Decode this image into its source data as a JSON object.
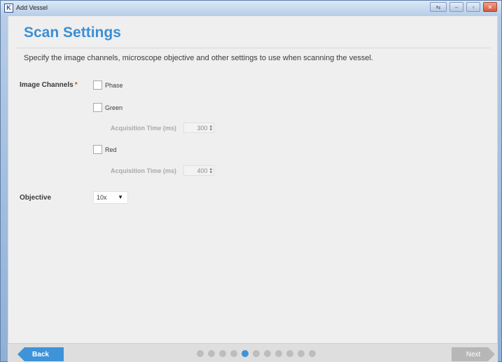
{
  "window": {
    "title": "Add Vessel",
    "icon_letter": "K",
    "buttons": [
      "restore-alt-icon",
      "minimize-icon",
      "maximize-icon",
      "close-icon"
    ]
  },
  "page": {
    "heading": "Scan Settings",
    "subtitle": "Specify the image channels, microscope objective and other settings to use when scanning the vessel."
  },
  "image_channels": {
    "label": "Image Channels",
    "required_mark": "*",
    "phase": {
      "label": "Phase",
      "checked": false
    },
    "green": {
      "label": "Green",
      "checked": false,
      "acq_label": "Acquisition Time (ms)",
      "acq_value": "300"
    },
    "red": {
      "label": "Red",
      "checked": false,
      "acq_label": "Acquisition Time (ms)",
      "acq_value": "400"
    }
  },
  "objective": {
    "label": "Objective",
    "value": "10x"
  },
  "footer": {
    "back_label": "Back",
    "next_label": "Next",
    "step_count": 11,
    "active_step": 4
  },
  "colors": {
    "accent": "#3f93d8",
    "heading": "#3b8fd4",
    "disabled": "#b7b7b7"
  }
}
